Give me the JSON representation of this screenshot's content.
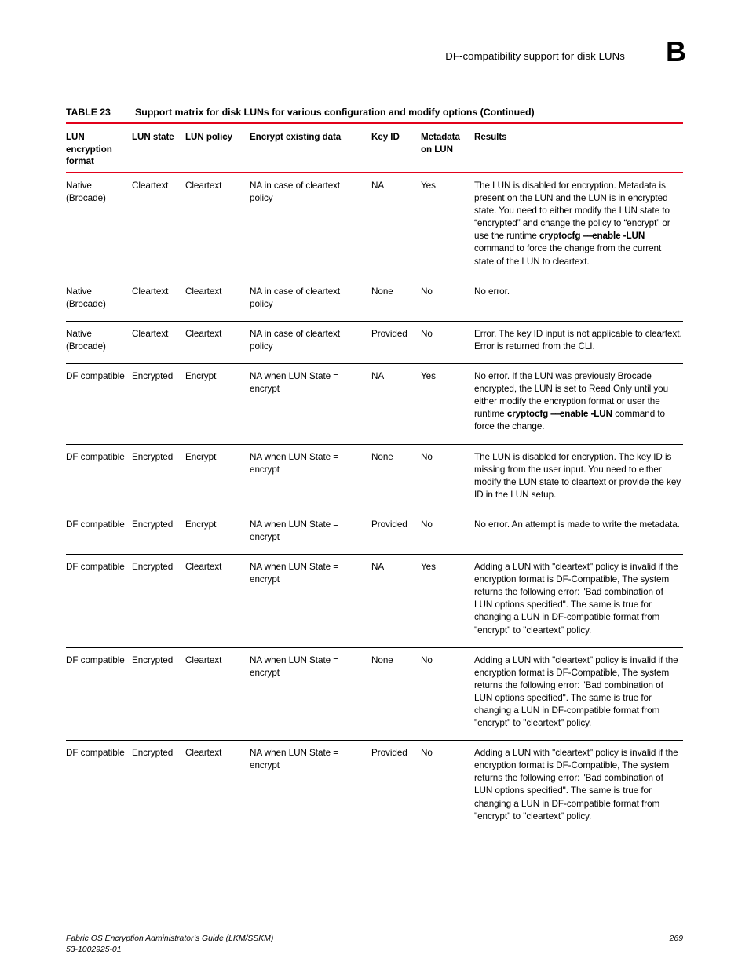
{
  "running_head": {
    "title": "DF-compatibility support for disk LUNs",
    "appendix_letter": "B"
  },
  "table_caption": {
    "label": "TABLE 23",
    "text": "Support matrix for disk LUNs for various configuration and modify options  (Continued)"
  },
  "rule_color": "#e2001a",
  "table": {
    "headers": [
      "LUN encryption format",
      "LUN state",
      "LUN policy",
      "Encrypt existing data",
      "Key ID",
      "Metadata on LUN",
      "Results"
    ],
    "header_lines": {
      "c0": [
        "LUN",
        "encryption",
        "format"
      ],
      "c1": [
        "LUN state"
      ],
      "c2": [
        "LUN policy"
      ],
      "c3": [
        "Encrypt existing data"
      ],
      "c4": [
        "Key ID"
      ],
      "c5": [
        "Metadata",
        "on LUN"
      ],
      "c6": [
        "Results"
      ]
    },
    "rows": [
      {
        "format": "Native (Brocade)",
        "state": "Cleartext",
        "policy": "Cleartext",
        "encrypt_existing": "NA in case of cleartext policy",
        "key_id": "NA",
        "metadata": "Yes",
        "results_pre": "The LUN is disabled for encryption. Metadata is present on the LUN and the LUN is in encrypted state. You need to either modify the LUN state to “encrypted” and change the policy to “encrypt” or use the runtime ",
        "results_cmd_name": "cryptocfg",
        "results_cmd_dash": "––",
        "results_cmd_opt": "enable -LUN",
        "results_post": " command to force the change from the current state of the LUN to cleartext."
      },
      {
        "format": "Native (Brocade)",
        "state": "Cleartext",
        "policy": "Cleartext",
        "encrypt_existing": "NA in case of cleartext policy",
        "key_id": "None",
        "metadata": "No",
        "results_pre": "No error.",
        "results_cmd_name": "",
        "results_cmd_dash": "",
        "results_cmd_opt": "",
        "results_post": ""
      },
      {
        "format": "Native (Brocade)",
        "state": "Cleartext",
        "policy": "Cleartext",
        "encrypt_existing": "NA in case of cleartext policy",
        "key_id": "Provided",
        "metadata": "No",
        "results_pre": "Error. The key ID input is not applicable to cleartext. Error is returned from the CLI.",
        "results_cmd_name": "",
        "results_cmd_dash": "",
        "results_cmd_opt": "",
        "results_post": ""
      },
      {
        "format": "DF compatible",
        "state": "Encrypted",
        "policy": "Encrypt",
        "encrypt_existing": "NA when LUN State = encrypt",
        "key_id": "NA",
        "metadata": "Yes",
        "results_pre": "No error. If the LUN was previously Brocade encrypted, the LUN is set to Read Only until you either modify the encryption format or user the runtime ",
        "results_cmd_name": "cryptocfg",
        "results_cmd_dash": "––",
        "results_cmd_opt": "enable -LUN",
        "results_post": " command to force the change."
      },
      {
        "format": "DF compatible",
        "state": "Encrypted",
        "policy": "Encrypt",
        "encrypt_existing": "NA when LUN State = encrypt",
        "key_id": "None",
        "metadata": "No",
        "results_pre": "The LUN is disabled for encryption. The key ID is missing from the user input. You need to either modify the LUN state to cleartext or provide the key ID in the LUN setup.",
        "results_cmd_name": "",
        "results_cmd_dash": "",
        "results_cmd_opt": "",
        "results_post": ""
      },
      {
        "format": "DF compatible",
        "state": "Encrypted",
        "policy": "Encrypt",
        "encrypt_existing": "NA when LUN State = encrypt",
        "key_id": "Provided",
        "metadata": "No",
        "results_pre": "No error. An attempt is made to write the metadata.",
        "results_cmd_name": "",
        "results_cmd_dash": "",
        "results_cmd_opt": "",
        "results_post": ""
      },
      {
        "format": "DF compatible",
        "state": "Encrypted",
        "policy": "Cleartext",
        "encrypt_existing": "NA when LUN State = encrypt",
        "key_id": "NA",
        "metadata": "Yes",
        "results_pre": "Adding a LUN with \"cleartext\" policy is invalid if the encryption format is DF-Compatible, The system returns the following error: \"Bad combination of LUN options specified\". The same is true for changing a LUN in DF-compatible format from \"encrypt\" to \"cleartext\" policy.",
        "results_cmd_name": "",
        "results_cmd_dash": "",
        "results_cmd_opt": "",
        "results_post": ""
      },
      {
        "format": "DF compatible",
        "state": "Encrypted",
        "policy": "Cleartext",
        "encrypt_existing": "NA when LUN State = encrypt",
        "key_id": "None",
        "metadata": "No",
        "results_pre": "Adding a LUN with \"cleartext\" policy is invalid if the encryption format is DF-Compatible, The system returns the following error: \"Bad combination of LUN options specified\". The same is true for changing a LUN in DF-compatible format from \"encrypt\" to \"cleartext\" policy.",
        "results_cmd_name": "",
        "results_cmd_dash": "",
        "results_cmd_opt": "",
        "results_post": ""
      },
      {
        "format": "DF compatible",
        "state": "Encrypted",
        "policy": "Cleartext",
        "encrypt_existing": "NA when LUN State = encrypt",
        "key_id": "Provided",
        "metadata": "No",
        "results_pre": "Adding a LUN with \"cleartext\" policy is invalid if the encryption format is DF-Compatible, The system returns the following error: \"Bad combination of LUN options specified\". The same is true for changing a LUN in DF-compatible format from \"encrypt\" to \"cleartext\" policy.",
        "results_cmd_name": "",
        "results_cmd_dash": "",
        "results_cmd_opt": "",
        "results_post": ""
      }
    ]
  },
  "footer": {
    "guide_title": "Fabric OS Encryption Administrator’s Guide  (LKM/SSKM)",
    "doc_number": "53-1002925-01",
    "page_number": "269"
  }
}
